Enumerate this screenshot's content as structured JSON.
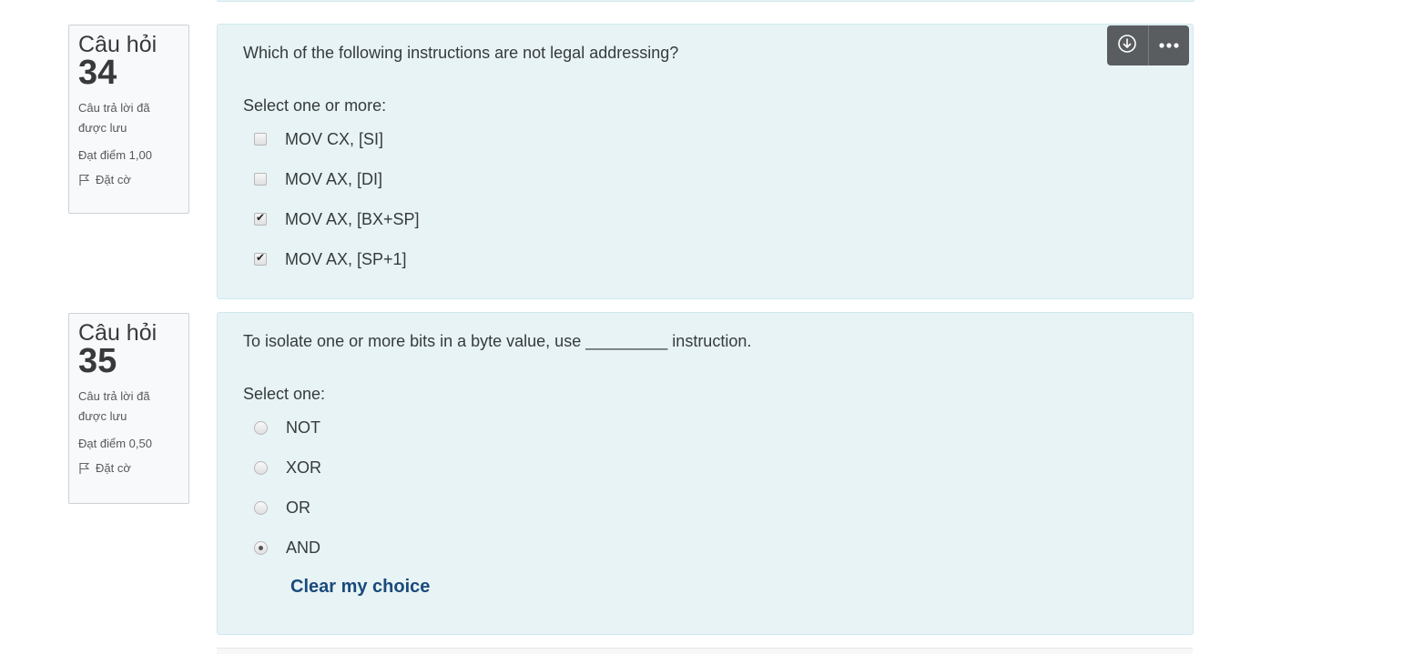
{
  "questions": [
    {
      "info": {
        "title": "Câu hỏi",
        "number": "34",
        "state": "Câu trả lời đã được lưu",
        "grade": "Đạt điểm 1,00",
        "flag_label": "Đặt cờ"
      },
      "question_text": "Which of the following instructions are not legal addressing?",
      "prompt": "Select one or more:",
      "type": "checkbox",
      "options": [
        {
          "label": "MOV CX, [SI]",
          "checked": false
        },
        {
          "label": "MOV AX, [DI]",
          "checked": false
        },
        {
          "label": "MOV AX, [BX+SP]",
          "checked": true
        },
        {
          "label": "MOV AX, [SP+1]",
          "checked": true
        }
      ]
    },
    {
      "info": {
        "title": "Câu hỏi",
        "number": "35",
        "state": "Câu trả lời đã được lưu",
        "grade": "Đạt điểm 0,50",
        "flag_label": "Đặt cờ"
      },
      "question_text": "To isolate one or more bits in a byte value, use _________ instruction.",
      "prompt": "Select one:",
      "type": "radio",
      "options": [
        {
          "label": "NOT",
          "checked": false
        },
        {
          "label": "XOR",
          "checked": false
        },
        {
          "label": "OR",
          "checked": false
        },
        {
          "label": "AND",
          "checked": true
        }
      ],
      "clear_label": "Clear my choice"
    }
  ],
  "toolbar": {
    "icons": [
      "download-circle-icon",
      "more-horizontal-icon"
    ]
  },
  "colors": {
    "question_bg": "#e7f3f5",
    "question_border": "#cfe9ed",
    "info_bg": "#f8f9fa",
    "link": "#1a4a7a",
    "toolbar_bg": "#5a5d60"
  }
}
